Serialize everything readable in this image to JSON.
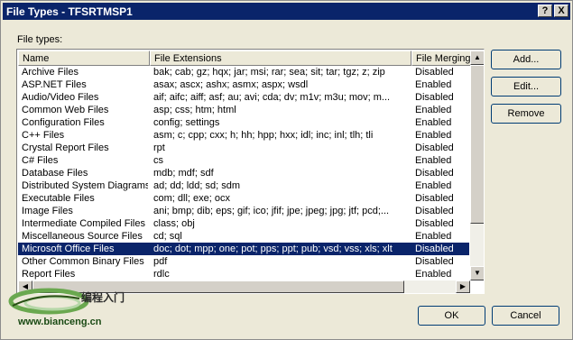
{
  "window": {
    "title": "File Types - TFSRTMSP1",
    "help_glyph": "?",
    "close_glyph": "X"
  },
  "label_file_types": "File types:",
  "columns": [
    "Name",
    "File Extensions",
    "File Merging"
  ],
  "rows": [
    {
      "name": "Archive Files",
      "ext": "bak; cab; gz; hqx; jar; msi; rar; sea; sit; tar; tgz; z; zip",
      "merge": "Disabled"
    },
    {
      "name": "ASP.NET Files",
      "ext": "asax; ascx; ashx; asmx; aspx; wsdl",
      "merge": "Enabled"
    },
    {
      "name": "Audio/Video Files",
      "ext": "aif; aifc; aiff; asf; au; avi; cda; dv; m1v; m3u; mov; m...",
      "merge": "Disabled"
    },
    {
      "name": "Common Web Files",
      "ext": "asp; css; htm; html",
      "merge": "Enabled"
    },
    {
      "name": "Configuration Files",
      "ext": "config; settings",
      "merge": "Enabled"
    },
    {
      "name": "C++ Files",
      "ext": "asm; c; cpp; cxx; h; hh; hpp; hxx; idl; inc; inl; tlh; tli",
      "merge": "Enabled"
    },
    {
      "name": "Crystal Report Files",
      "ext": "rpt",
      "merge": "Disabled"
    },
    {
      "name": "C# Files",
      "ext": "cs",
      "merge": "Enabled"
    },
    {
      "name": "Database Files",
      "ext": "mdb; mdf; sdf",
      "merge": "Disabled"
    },
    {
      "name": "Distributed System Diagrams",
      "ext": "ad; dd; ldd; sd; sdm",
      "merge": "Enabled"
    },
    {
      "name": "Executable Files",
      "ext": "com; dll; exe; ocx",
      "merge": "Disabled"
    },
    {
      "name": "Image Files",
      "ext": "ani; bmp; dib; eps; gif; ico; jfif; jpe; jpeg; jpg; jtf; pcd;...",
      "merge": "Disabled"
    },
    {
      "name": "Intermediate Compiled Files",
      "ext": "class; obj",
      "merge": "Disabled"
    },
    {
      "name": "Miscellaneous Source Files",
      "ext": "cd; sql",
      "merge": "Enabled"
    },
    {
      "name": "Microsoft Office Files",
      "ext": "doc; dot; mpp; one; pot; pps; ppt; pub; vsd; vss; xls; xlt",
      "merge": "Disabled",
      "selected": true
    },
    {
      "name": "Other Common Binary Files",
      "ext": "pdf",
      "merge": "Disabled"
    },
    {
      "name": "Report Files",
      "ext": "rdlc",
      "merge": "Enabled"
    }
  ],
  "buttons": {
    "add": "Add...",
    "edit": "Edit...",
    "remove": "Remove",
    "ok": "OK",
    "cancel": "Cancel"
  },
  "watermark": {
    "title": "编程入门",
    "url": "www.bianceng.cn"
  },
  "colors": {
    "titlebar": "#0a246a",
    "selection": "#0a246a",
    "dialog_bg": "#ece9d8"
  }
}
